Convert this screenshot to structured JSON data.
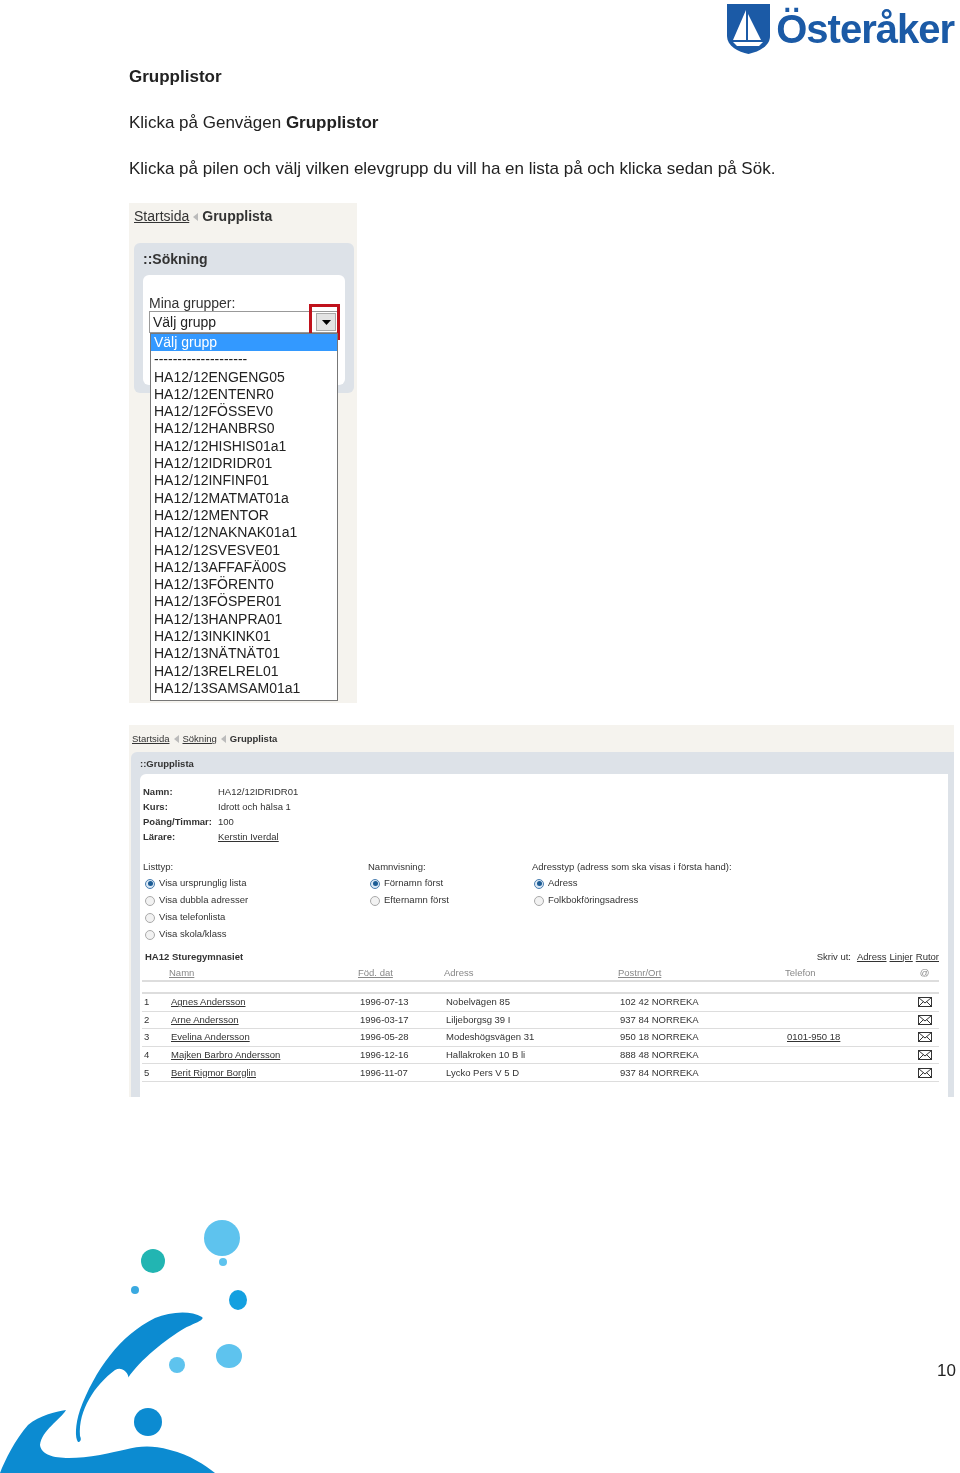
{
  "logo": {
    "text": "Österåker"
  },
  "heading": "Grupplistor",
  "paragraphs": [
    "Klicka på Genvägen **Grupplistor**",
    "Klicka på pilen och välj vilken elevgrupp du vill ha en lista på och klicka sedan på Sök."
  ],
  "search_screen": {
    "breadcrumb": [
      {
        "label": "Startsida",
        "link": true
      },
      {
        "label": "Grupplista",
        "link": false
      }
    ],
    "panel_title": "::Sökning",
    "field_label": "Mina grupper:",
    "select_value": "Välj grupp",
    "highlighted": true,
    "dropdown": {
      "expanded": true,
      "options": [
        {
          "label": "Välj grupp",
          "selected": true
        },
        {
          "label": "--------------------",
          "selected": false
        },
        {
          "label": "HA12/12ENGENG05",
          "selected": false
        },
        {
          "label": "HA12/12ENTENR0",
          "selected": false
        },
        {
          "label": "HA12/12FÖSSEV0",
          "selected": false
        },
        {
          "label": "HA12/12HANBRS0",
          "selected": false
        },
        {
          "label": "HA12/12HISHIS01a1",
          "selected": false
        },
        {
          "label": "HA12/12IDRIDR01",
          "selected": false
        },
        {
          "label": "HA12/12INFINF01",
          "selected": false
        },
        {
          "label": "HA12/12MATMAT01a",
          "selected": false
        },
        {
          "label": "HA12/12MENTOR",
          "selected": false
        },
        {
          "label": "HA12/12NAKNAK01a1",
          "selected": false
        },
        {
          "label": "HA12/12SVESVE01",
          "selected": false
        },
        {
          "label": "HA12/13AFFAFÄ00S",
          "selected": false
        },
        {
          "label": "HA12/13FÖRENT0",
          "selected": false
        },
        {
          "label": "HA12/13FÖSPER01",
          "selected": false
        },
        {
          "label": "HA12/13HANPRA01",
          "selected": false
        },
        {
          "label": "HA12/13INKINK01",
          "selected": false
        },
        {
          "label": "HA12/13NÄTNÄT01",
          "selected": false
        },
        {
          "label": "HA12/13RELREL01",
          "selected": false
        },
        {
          "label": "HA12/13SAMSAM01a1",
          "selected": false
        }
      ]
    }
  },
  "list_screen": {
    "breadcrumb": [
      {
        "label": "Startsida",
        "link": true
      },
      {
        "label": "Sökning",
        "link": true
      },
      {
        "label": "Grupplista",
        "link": false
      }
    ],
    "panel_title": "::Grupplista",
    "info": [
      {
        "label": "Namn:",
        "value": "HA12/12IDRIDR01",
        "link": false
      },
      {
        "label": "Kurs:",
        "value": "Idrott och hälsa 1",
        "link": false
      },
      {
        "label": "Poäng/Timmar:",
        "value": "100",
        "link": false
      },
      {
        "label": "Lärare:",
        "value": "Kerstin Iverdal",
        "link": true
      }
    ],
    "radio_groups": [
      {
        "label": "Listtyp:",
        "options": [
          {
            "label": "Visa ursprunglig lista",
            "selected": true
          },
          {
            "label": "Visa dubbla adresser",
            "selected": false
          },
          {
            "label": "Visa telefonlista",
            "selected": false
          },
          {
            "label": "Visa skola/klass",
            "selected": false
          }
        ]
      },
      {
        "label": "Namnvisning:",
        "options": [
          {
            "label": "Förnamn först",
            "selected": true
          },
          {
            "label": "Efternamn först",
            "selected": false
          }
        ]
      },
      {
        "label": "Adresstyp (adress som ska visas i första hand):",
        "options": [
          {
            "label": "Adress",
            "selected": true
          },
          {
            "label": "Folkbokföringsadress",
            "selected": false
          }
        ]
      }
    ],
    "table": {
      "title": "HA12 Sturegymnasiet",
      "print_label": "Skriv ut:",
      "print_links": [
        "Adress",
        "Linjer",
        "Rutor"
      ],
      "columns": [
        {
          "label": "Namn",
          "link": true
        },
        {
          "label": "Föd. dat",
          "link": true
        },
        {
          "label": "Adress",
          "link": false
        },
        {
          "label": "Postnr/Ort",
          "link": true
        },
        {
          "label": "Telefon",
          "link": false
        },
        {
          "label": "@",
          "link": false
        }
      ],
      "rows": [
        {
          "number": "1",
          "name": "Agnes Andersson",
          "born": "1996-07-13",
          "address": "Nobelvägen 85",
          "postal": "102 42 NORREKA",
          "phone": ""
        },
        {
          "number": "2",
          "name": "Arne Andersson",
          "born": "1996-03-17",
          "address": "Liljeborgsg 39 I",
          "postal": "937 84 NORREKA",
          "phone": ""
        },
        {
          "number": "3",
          "name": "Evelina Andersson",
          "born": "1996-05-28",
          "address": "Modeshögsvägen 31",
          "postal": "950 18 NORREKA",
          "phone": "0101-950 18"
        },
        {
          "number": "4",
          "name": "Majken Barbro Andersson",
          "born": "1996-12-16",
          "address": "Hallakroken 10 B li",
          "postal": "888 48 NORREKA",
          "phone": ""
        },
        {
          "number": "5",
          "name": "Berit Rigmor Borglin",
          "born": "1996-11-07",
          "address": "Lycko Pers V 5 D",
          "postal": "937 84 NORREKA",
          "phone": ""
        }
      ]
    }
  },
  "page_number": "10"
}
